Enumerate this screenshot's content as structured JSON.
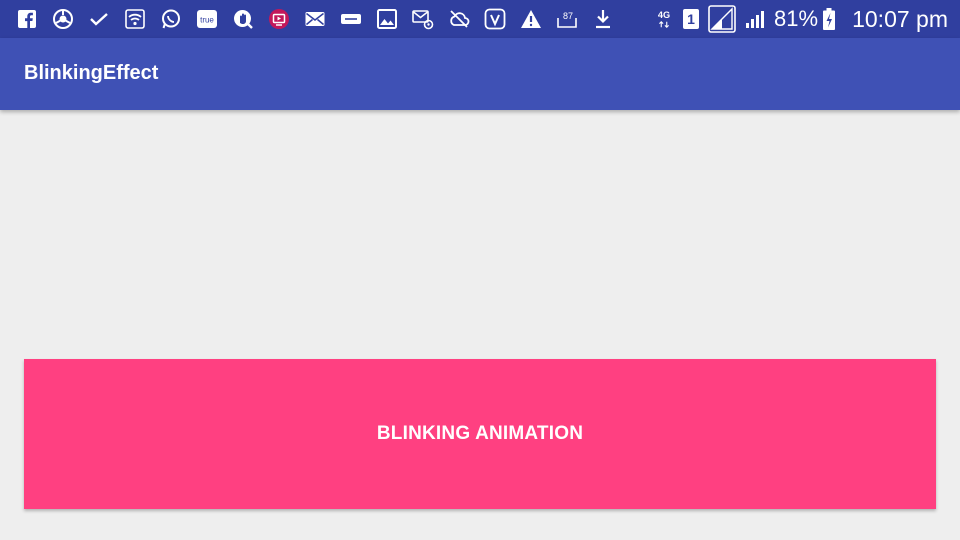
{
  "status_bar": {
    "notification_icons": [
      "facebook-icon",
      "browser-icon",
      "check-icon",
      "wifi-icon",
      "whatsapp-icon",
      "truecaller-icon",
      "hand-icon",
      "video-icon",
      "email-icon",
      "app-icon",
      "gallery-icon",
      "mail-settings-icon",
      "cloud-off-icon",
      "saavn-icon",
      "warning-icon",
      "storage-icon",
      "download-icon"
    ],
    "truecaller_text": "true",
    "storage_badge": "87",
    "network_type": "4G",
    "sim_slot": "1",
    "battery_percent": "81%",
    "time": "10:07 pm"
  },
  "app_bar": {
    "title": "BlinkingEffect"
  },
  "main": {
    "button_label": "BLINKING ANIMATION"
  },
  "colors": {
    "status_bar": "#303f9f",
    "primary": "#3f51b5",
    "accent": "#ff4081",
    "background": "#eeeeee"
  }
}
